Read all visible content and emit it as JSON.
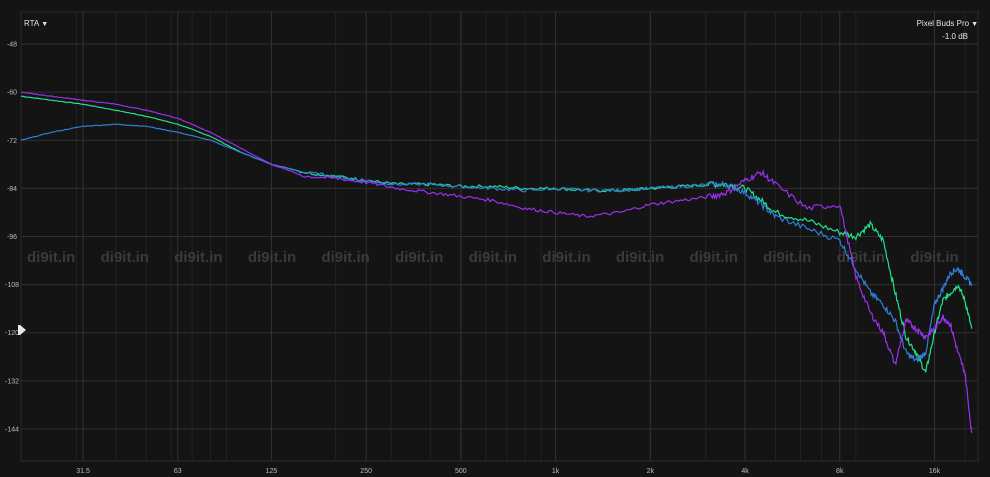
{
  "header": {
    "left_menu_label": "RTA",
    "right_menu_label": "Pixel Buds Pro",
    "offset_label": "-1.0 dB",
    "menu_icon": "triangle-down-icon"
  },
  "watermark": {
    "text": "di9it.in",
    "repeat": 13
  },
  "colors": {
    "background": "#141414",
    "grid": "#2e2e2e",
    "green_series": "#22e08a",
    "blue_series": "#2f7ed8",
    "purple_series": "#9b2ff0"
  },
  "chart_data": {
    "type": "line",
    "title": "",
    "xlabel": "",
    "ylabel": "",
    "x_scale": "log",
    "xlim": [
      20,
      22000
    ],
    "ylim": [
      -152,
      -40
    ],
    "x_ticks": [
      {
        "value": 31.5,
        "label": "31.5"
      },
      {
        "value": 63,
        "label": "63"
      },
      {
        "value": 125,
        "label": "125"
      },
      {
        "value": 250,
        "label": "250"
      },
      {
        "value": 500,
        "label": "500"
      },
      {
        "value": 1000,
        "label": "1k"
      },
      {
        "value": 2000,
        "label": "2k"
      },
      {
        "value": 4000,
        "label": "4k"
      },
      {
        "value": 8000,
        "label": "8k"
      },
      {
        "value": 16000,
        "label": "16k"
      }
    ],
    "y_ticks": [
      {
        "value": -48,
        "label": "-48"
      },
      {
        "value": -60,
        "label": "-60"
      },
      {
        "value": -72,
        "label": "-72"
      },
      {
        "value": -84,
        "label": "-84"
      },
      {
        "value": -96,
        "label": "-96"
      },
      {
        "value": -108,
        "label": "-108"
      },
      {
        "value": -120,
        "label": "-120"
      },
      {
        "value": -132,
        "label": "-132"
      },
      {
        "value": -144,
        "label": "-144"
      }
    ],
    "grid": true,
    "legend": "none",
    "series": [
      {
        "color": "#22e08a",
        "x": [
          20,
          25,
          31.5,
          40,
          50,
          63,
          80,
          100,
          125,
          160,
          200,
          250,
          315,
          400,
          500,
          630,
          800,
          1000,
          1250,
          1600,
          2000,
          2500,
          3150,
          3500,
          4000,
          4500,
          5000,
          6300,
          8000,
          9000,
          10000,
          11000,
          12000,
          13000,
          14000,
          15000,
          16000,
          17000,
          18000,
          19000,
          20000,
          21000
        ],
        "y": [
          -61,
          -62,
          -63,
          -64.5,
          -66,
          -68,
          -71,
          -75,
          -78,
          -80,
          -81,
          -82,
          -83,
          -83,
          -83.5,
          -83.5,
          -84,
          -84,
          -84.5,
          -84.5,
          -84,
          -83.5,
          -83,
          -83,
          -84,
          -87,
          -90,
          -92,
          -95,
          -96,
          -93,
          -97,
          -110,
          -121,
          -125,
          -130,
          -120,
          -112,
          -110,
          -108,
          -112,
          -119
        ]
      },
      {
        "color": "#2f7ed8",
        "x": [
          20,
          25,
          31.5,
          40,
          50,
          63,
          80,
          100,
          125,
          160,
          200,
          250,
          315,
          400,
          500,
          630,
          800,
          1000,
          1250,
          1600,
          2000,
          2500,
          3150,
          3500,
          4000,
          4500,
          5000,
          6300,
          8000,
          9000,
          10000,
          11000,
          12000,
          13000,
          14000,
          15000,
          16000,
          17000,
          18000,
          19000,
          20000,
          21000
        ],
        "y": [
          -72,
          -70,
          -68.5,
          -68,
          -68.5,
          -70,
          -72,
          -75,
          -78,
          -80,
          -81,
          -82,
          -83,
          -83,
          -83.5,
          -84,
          -84.5,
          -84,
          -84.5,
          -84.5,
          -84,
          -83.5,
          -83,
          -83,
          -85,
          -88,
          -91,
          -94,
          -97,
          -104,
          -110,
          -113,
          -117,
          -125,
          -127,
          -125,
          -113,
          -109,
          -105,
          -104,
          -106,
          -108
        ]
      },
      {
        "color": "#9b2ff0",
        "x": [
          20,
          25,
          31.5,
          40,
          50,
          63,
          80,
          100,
          125,
          160,
          200,
          250,
          315,
          400,
          500,
          630,
          800,
          1000,
          1250,
          1600,
          2000,
          2500,
          3150,
          3500,
          4000,
          4500,
          5000,
          6300,
          8000,
          9000,
          10000,
          11000,
          12000,
          13000,
          14000,
          15000,
          16000,
          17000,
          18000,
          19000,
          20000,
          21000
        ],
        "y": [
          -60,
          -61,
          -62,
          -63,
          -64.5,
          -66.5,
          -70,
          -74,
          -78,
          -81,
          -81.5,
          -82.5,
          -84,
          -85,
          -86,
          -87,
          -89,
          -90,
          -91,
          -90,
          -88,
          -87,
          -86,
          -85,
          -82,
          -80,
          -83,
          -89,
          -88,
          -106,
          -115,
          -120,
          -128,
          -117,
          -119,
          -121,
          -119,
          -116,
          -118,
          -125,
          -130,
          -145
        ]
      }
    ]
  }
}
